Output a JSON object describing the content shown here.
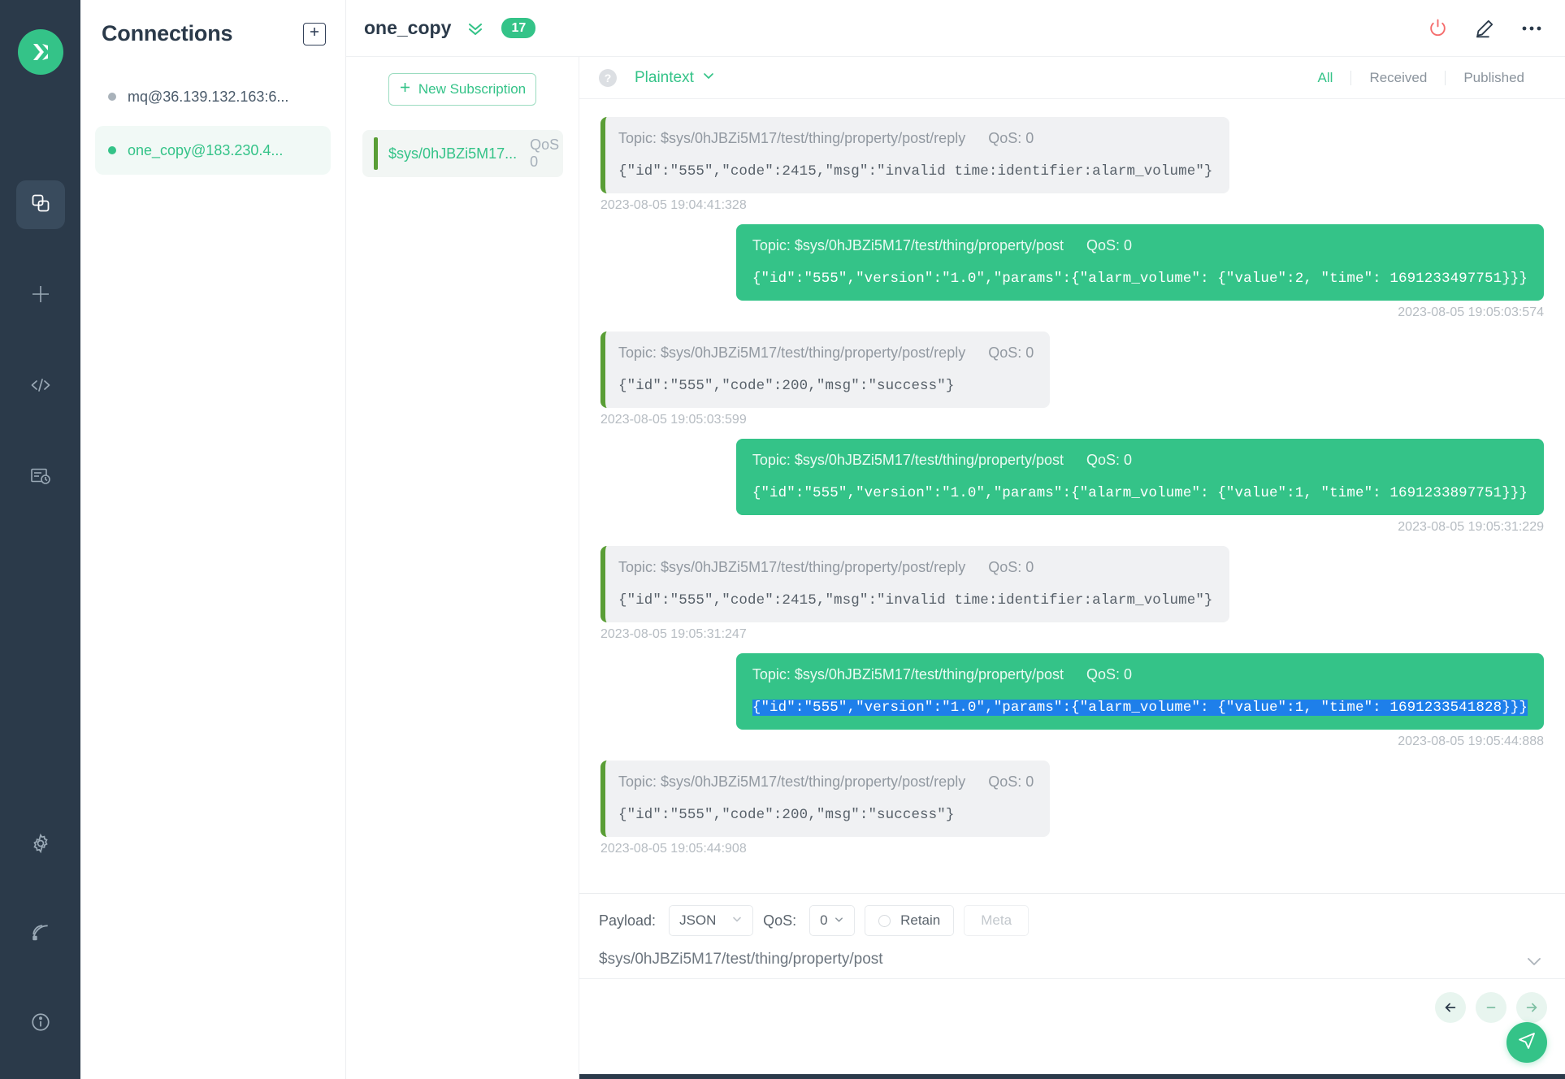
{
  "app": {
    "logo_icon": "mqttx-logo-icon",
    "rail_icons": [
      {
        "name": "connections-icon",
        "active": true
      },
      {
        "name": "new-connection-icon",
        "active": false
      },
      {
        "name": "script-code-icon",
        "active": false
      },
      {
        "name": "log-history-icon",
        "active": false
      }
    ],
    "rail_bottom_icons": [
      {
        "name": "settings-gear-icon"
      },
      {
        "name": "broadcast-icon"
      },
      {
        "name": "info-icon"
      }
    ]
  },
  "connections": {
    "title": "Connections",
    "add_button_label": "+",
    "items": [
      {
        "name": "mq@36.139.132.163:6...",
        "status": "offline",
        "selected": false
      },
      {
        "name": "one_copy@183.230.4...",
        "status": "online",
        "selected": true
      }
    ]
  },
  "topbar": {
    "title": "one_copy",
    "expand_icon": "double-chevron-down-icon",
    "badge_count": "17",
    "actions": [
      {
        "name": "disconnect-power-icon"
      },
      {
        "name": "edit-pencil-icon"
      },
      {
        "name": "more-options-icon"
      }
    ]
  },
  "subscriptions": {
    "new_button_label": "New Subscription",
    "items": [
      {
        "topic": "$sys/0hJBZi5M17...",
        "qos": "QoS 0"
      }
    ]
  },
  "messages_toolbar": {
    "help_icon": "question-mark-icon",
    "format": "Plaintext",
    "format_caret": "chevron-down-icon",
    "filters": [
      {
        "label": "All",
        "active": true
      },
      {
        "label": "Received",
        "active": false
      },
      {
        "label": "Published",
        "active": false
      }
    ]
  },
  "messages": [
    {
      "direction": "in",
      "topic_label": "Topic: $sys/0hJBZi5M17/test/thing/property/post/reply",
      "qos_label": "QoS: 0",
      "payload": "{\"id\":\"555\",\"code\":2415,\"msg\":\"invalid time:identifier:alarm_volume\"}",
      "time": "2023-08-05 19:04:41:328",
      "selected": false
    },
    {
      "direction": "out",
      "topic_label": "Topic: $sys/0hJBZi5M17/test/thing/property/post",
      "qos_label": "QoS: 0",
      "payload": "{\"id\":\"555\",\"version\":\"1.0\",\"params\":{\"alarm_volume\": {\"value\":2, \"time\": 1691233497751}}}",
      "time": "2023-08-05 19:05:03:574",
      "selected": false
    },
    {
      "direction": "in",
      "topic_label": "Topic: $sys/0hJBZi5M17/test/thing/property/post/reply",
      "qos_label": "QoS: 0",
      "payload": "{\"id\":\"555\",\"code\":200,\"msg\":\"success\"}",
      "time": "2023-08-05 19:05:03:599",
      "selected": false
    },
    {
      "direction": "out",
      "topic_label": "Topic: $sys/0hJBZi5M17/test/thing/property/post",
      "qos_label": "QoS: 0",
      "payload": "{\"id\":\"555\",\"version\":\"1.0\",\"params\":{\"alarm_volume\": {\"value\":1, \"time\": 1691233897751}}}",
      "time": "2023-08-05 19:05:31:229",
      "selected": false
    },
    {
      "direction": "in",
      "topic_label": "Topic: $sys/0hJBZi5M17/test/thing/property/post/reply",
      "qos_label": "QoS: 0",
      "payload": "{\"id\":\"555\",\"code\":2415,\"msg\":\"invalid time:identifier:alarm_volume\"}",
      "time": "2023-08-05 19:05:31:247",
      "selected": false
    },
    {
      "direction": "out",
      "topic_label": "Topic: $sys/0hJBZi5M17/test/thing/property/post",
      "qos_label": "QoS: 0",
      "payload": "{\"id\":\"555\",\"version\":\"1.0\",\"params\":{\"alarm_volume\": {\"value\":1, \"time\": 1691233541828}}}",
      "time": "2023-08-05 19:05:44:888",
      "selected": true
    },
    {
      "direction": "in",
      "topic_label": "Topic: $sys/0hJBZi5M17/test/thing/property/post/reply",
      "qos_label": "QoS: 0",
      "payload": "{\"id\":\"555\",\"code\":200,\"msg\":\"success\"}",
      "time": "2023-08-05 19:05:44:908",
      "selected": false
    }
  ],
  "publish": {
    "payload_label": "Payload:",
    "payload_value": "JSON",
    "qos_label": "QoS:",
    "qos_value": "0",
    "retain_label": "Retain",
    "retain_checked": false,
    "meta_label": "Meta",
    "topic": "$sys/0hJBZi5M17/test/thing/property/post",
    "editor_value": "",
    "collapse_icon": "chevron-down-icon",
    "nav": [
      {
        "name": "history-back-arrow-icon",
        "enabled": true
      },
      {
        "name": "history-minus-icon",
        "enabled": false
      },
      {
        "name": "history-forward-arrow-icon",
        "enabled": false
      }
    ],
    "send_icon": "send-paper-plane-icon"
  },
  "colors": {
    "accent": "#34c388",
    "rail_bg": "#2b3a4a",
    "received_bubble": "#f0f1f3",
    "received_bar": "#5a9e36",
    "selection_blue": "#1e7fea",
    "danger": "#f56c6c"
  }
}
